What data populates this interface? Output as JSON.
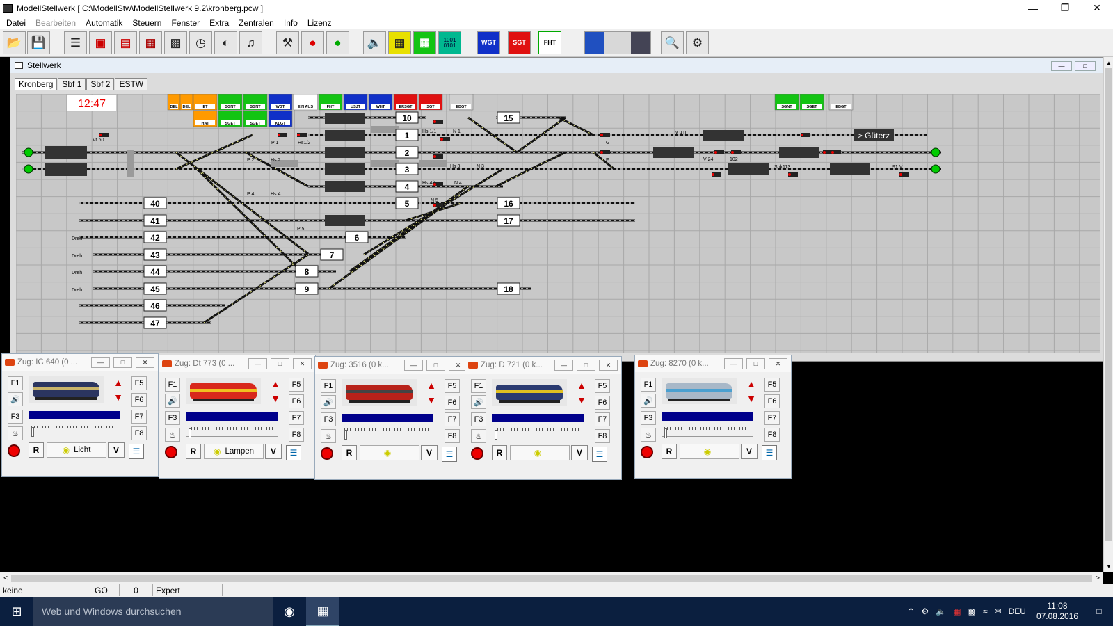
{
  "window": {
    "title": "ModellStellwerk [ C:\\ModellStw\\ModellStellwerk 9.2\\kronberg.pcw ]"
  },
  "menu": [
    "Datei",
    "Bearbeiten",
    "Automatik",
    "Steuern",
    "Fenster",
    "Extra",
    "Zentralen",
    "Info",
    "Lizenz"
  ],
  "toolbar": {
    "labels": {
      "wgt": "WGT",
      "sgt": "SGT",
      "fht": "FHT",
      "bin_top": "1001",
      "bin_bot": "0101"
    },
    "icons": [
      "open-folder-icon",
      "save-icon",
      "track-editor-icon",
      "locomotive-icon",
      "train-icon",
      "wagon-icon",
      "controller-icon",
      "clock-icon",
      "speedometer-icon",
      "sound-icon",
      "tools-icon",
      "signal-red-icon",
      "signal-green-icon",
      "speaker-icon",
      "yellow-panel-icon",
      "green-panel-icon",
      "binary-icon",
      "wgt-icon",
      "sgt-icon",
      "fht-icon",
      "connection-icon",
      "search-icon",
      "settings-icon"
    ]
  },
  "stellwerk": {
    "title": "Stellwerk",
    "tabs": [
      "Kronberg",
      "Sbf 1",
      "Sbf 2",
      "ESTW"
    ],
    "clock": "12:47",
    "buttons": [
      {
        "label": "DEL",
        "color": "#ff9a00"
      },
      {
        "label": "DEL",
        "color": "#ff9a00"
      },
      {
        "label": "ET",
        "color": "#ff9a00"
      },
      {
        "label": "HAT",
        "color": "#ff9a00"
      },
      {
        "label": "SGNT",
        "color": "#13c413"
      },
      {
        "label": "SGNT",
        "color": "#13c413"
      },
      {
        "label": "SGET",
        "color": "#13c413"
      },
      {
        "label": "SGET",
        "color": "#13c413"
      },
      {
        "label": "WGT",
        "color": "#1030c8"
      },
      {
        "label": "KLGT",
        "color": "#1030c8"
      },
      {
        "label": "EIN AUS",
        "color": "#ffffff"
      },
      {
        "label": "FHT",
        "color": "#13c413"
      },
      {
        "label": "USJT",
        "color": "#1030c8"
      },
      {
        "label": "WHT",
        "color": "#1030c8"
      },
      {
        "label": "ERSGT",
        "color": "#e01010"
      },
      {
        "label": "SGT",
        "color": "#e01010"
      },
      {
        "label": "EBGT",
        "color": "#d0d0d0"
      },
      {
        "label": "SGNT",
        "color": "#13c413"
      },
      {
        "label": "SGET",
        "color": "#13c413"
      },
      {
        "label": "EBGT",
        "color": "#d0d0d0"
      }
    ],
    "small_labels": {
      "vr60": "Vr 60",
      "dreh": "Dreh",
      "v24": "V 24",
      "sbk113": "Sbk113",
      "v91": "91 V",
      "vun": "v u n",
      "guterz": "> Güterz",
      "hs11": "Hs 1/1",
      "hs12": "Hs1/2",
      "hs41": "Hs 4/1",
      "hs3": "Hs 3",
      "n1": "N 1",
      "n3": "N 3",
      "n4": "N 4",
      "n5": "N 5",
      "p1": "P 1",
      "p2": "P 2",
      "p4": "P 4",
      "p5": "P 5",
      "hs2": "Hs 2",
      "hs4": "Hs 4",
      "g": "G",
      "f": "F",
      "nr": "102",
      "et_val": "1",
      "wht_val": "5",
      "sgt_val": "0",
      "ft_val": "66"
    },
    "tracks": [
      "10",
      "1",
      "2",
      "3",
      "4",
      "5",
      "6",
      "7",
      "8",
      "9",
      "15",
      "16",
      "17",
      "18",
      "40",
      "41",
      "42",
      "43",
      "44",
      "45",
      "46",
      "47"
    ]
  },
  "trains": [
    {
      "title": "Zug: IC 640 (0 ...",
      "light": "Licht",
      "left": "F1",
      "l2": "F2",
      "l3": "F3",
      "r1": "F5",
      "r2": "F6",
      "r3": "F7",
      "r4": "F8",
      "r": "R",
      "v": "V",
      "loco_color": "#2b3560",
      "loco_accent": "#c9b46a"
    },
    {
      "title": "Zug: Dt 773 (0 ...",
      "light": "Lampen",
      "left": "F1",
      "l2": "F2",
      "l3": "F3",
      "r1": "F5",
      "r2": "F6",
      "r3": "F7",
      "r4": "F8",
      "r": "R",
      "v": "V",
      "loco_color": "#d8281c",
      "loco_accent": "#f0c020"
    },
    {
      "title": "Zug: 3516 (0 k...",
      "light": "",
      "left": "F1",
      "l2": "F2",
      "l3": "F3",
      "r1": "F5",
      "r2": "F6",
      "r3": "F7",
      "r4": "F8",
      "r": "R",
      "v": "V",
      "loco_color": "#b8221a",
      "loco_accent": "#444444"
    },
    {
      "title": "Zug: D 721 (0 k...",
      "light": "",
      "left": "F1",
      "l2": "F2",
      "l3": "F3",
      "r1": "F5",
      "r2": "F6",
      "r3": "F7",
      "r4": "F8",
      "r": "R",
      "v": "V",
      "loco_color": "#2a3a70",
      "loco_accent": "#e0c020"
    },
    {
      "title": "Zug: 8270 (0 k...",
      "light": "",
      "left": "F1",
      "l2": "F2",
      "l3": "F3",
      "r1": "F5",
      "r2": "F6",
      "r3": "F7",
      "r4": "F8",
      "r": "R",
      "v": "V",
      "loco_color": "#a8b8c8",
      "loco_accent": "#4aa0d0"
    }
  ],
  "status": {
    "mode": "keine",
    "go": "GO",
    "count": "0",
    "level": "Expert"
  },
  "taskbar": {
    "search_placeholder": "Web und Windows durchsuchen",
    "lang": "DEU",
    "time": "11:08",
    "date": "07.08.2016"
  }
}
